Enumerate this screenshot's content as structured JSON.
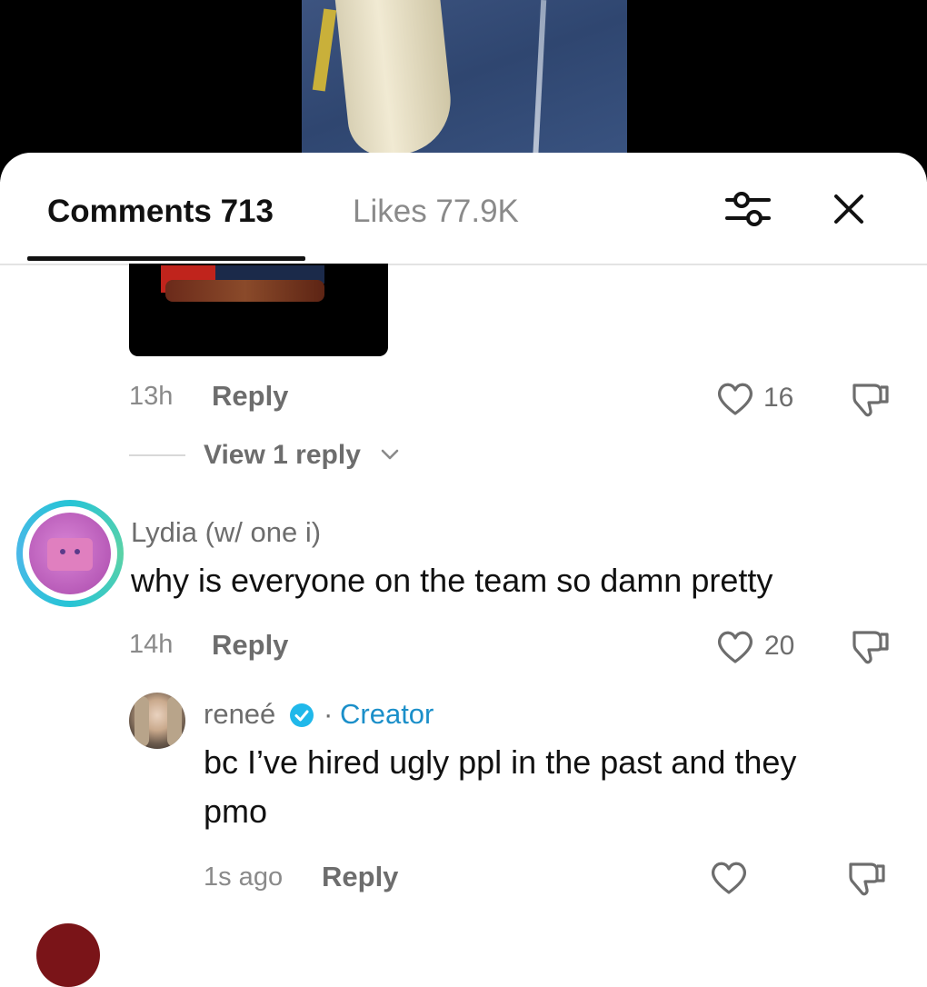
{
  "video": {
    "background": "#000000"
  },
  "tabs": {
    "comments_label": "Comments 713",
    "likes_label": "Likes 77.9K"
  },
  "header_icons": {
    "filter": "sliders-icon",
    "close": "close-icon"
  },
  "comments": [
    {
      "time": "13h",
      "reply_label": "Reply",
      "likes": "16",
      "has_image": true,
      "view_replies": "View 1 reply"
    },
    {
      "username": "Lydia (w/ one i)",
      "text": "why is everyone on the team so damn pretty",
      "time": "14h",
      "reply_label": "Reply",
      "likes": "20",
      "replies": [
        {
          "username": "reneé",
          "verified": true,
          "separator": "·",
          "badge": "Creator",
          "text_line1": "bc I’ve hired ugly ppl in the past and they",
          "text_line2": "pmo",
          "time": "1s ago",
          "reply_label": "Reply"
        }
      ]
    }
  ],
  "colors": {
    "accent_creator": "#1b8fc9",
    "story_ring": "#27c4d6",
    "muted_text": "#6d6d6d"
  }
}
